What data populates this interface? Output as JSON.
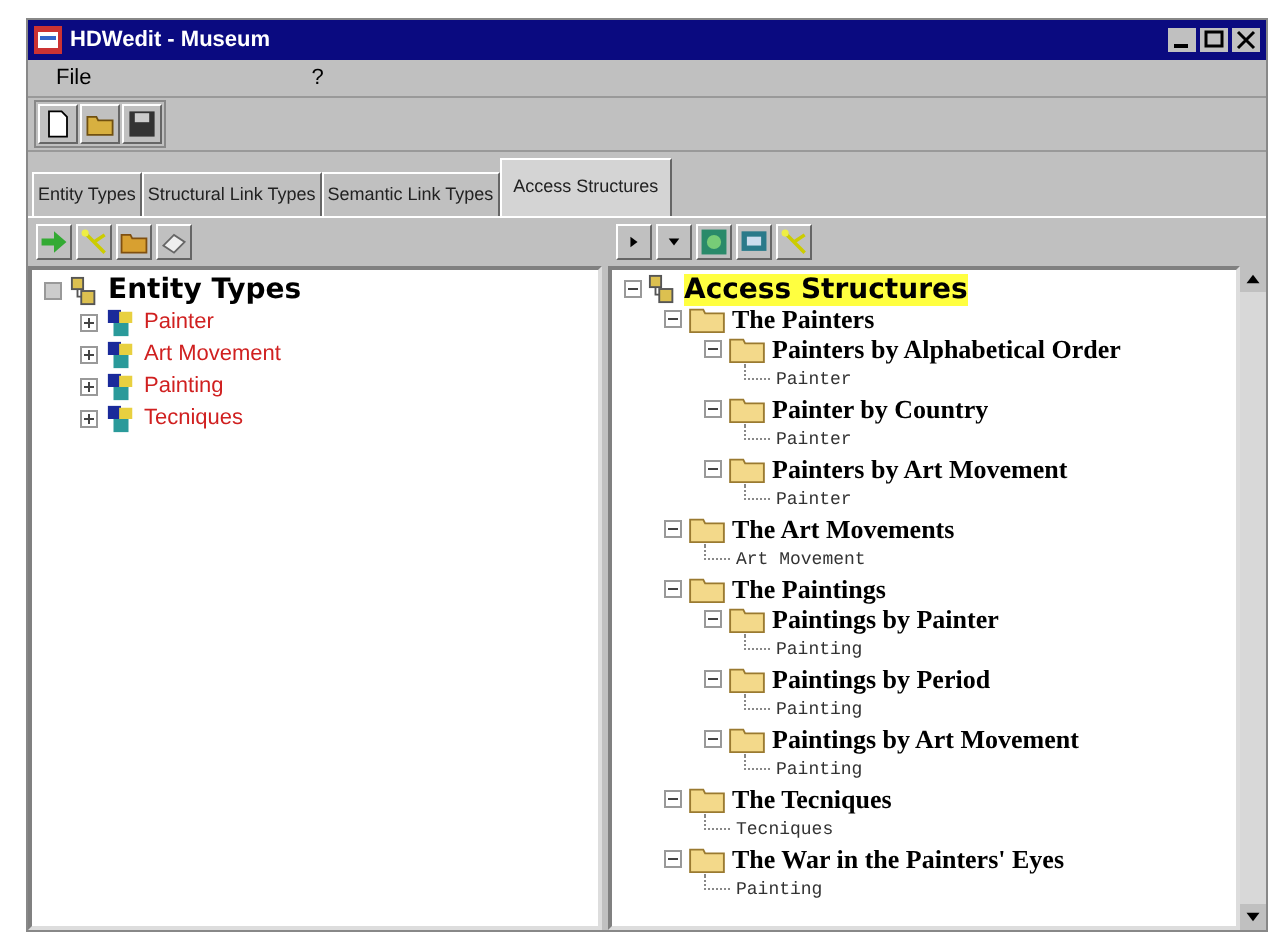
{
  "window": {
    "title": "HDWedit - Museum"
  },
  "menu": [
    "File",
    "?"
  ],
  "tabs": [
    {
      "label": "Entity Types",
      "selected": false
    },
    {
      "label": "Structural Link Types",
      "selected": false
    },
    {
      "label": "Semantic Link Types",
      "selected": false
    },
    {
      "label": "Access Structures",
      "selected": true
    }
  ],
  "entity_tree": {
    "label": "Entity Types",
    "children": [
      {
        "label": "Painter",
        "expanded": false
      },
      {
        "label": "Art Movement",
        "expanded": false
      },
      {
        "label": "Painting",
        "expanded": false
      },
      {
        "label": "Tecniques",
        "expanded": false
      }
    ]
  },
  "access_tree": {
    "label": "Access Structures",
    "selected": true,
    "expanded": true,
    "children": [
      {
        "kind": "folder",
        "label": "The Painters",
        "selected": false,
        "expanded": true,
        "children": [
          {
            "kind": "folder",
            "label": "Painters by Alphabetical Order",
            "selected": false,
            "expanded": true,
            "children": [
              {
                "kind": "ref",
                "label": "Painter",
                "selected": false
              }
            ]
          },
          {
            "kind": "folder",
            "label": "Painter by Country",
            "selected": false,
            "expanded": true,
            "children": [
              {
                "kind": "ref",
                "label": "Painter",
                "selected": false
              }
            ]
          },
          {
            "kind": "folder",
            "label": "Painters by Art Movement",
            "selected": false,
            "expanded": true,
            "children": [
              {
                "kind": "ref",
                "label": "Painter",
                "selected": false
              }
            ]
          }
        ]
      },
      {
        "kind": "folder",
        "label": "The Art Movements",
        "selected": false,
        "expanded": true,
        "children": [
          {
            "kind": "ref",
            "label": "Art Movement",
            "selected": false
          }
        ]
      },
      {
        "kind": "folder",
        "label": "The Paintings",
        "selected": false,
        "expanded": true,
        "children": [
          {
            "kind": "folder",
            "label": "Paintings by Painter",
            "selected": false,
            "expanded": true,
            "children": [
              {
                "kind": "ref",
                "label": "Painting",
                "selected": false
              }
            ]
          },
          {
            "kind": "folder",
            "label": "Paintings by Period",
            "selected": false,
            "expanded": true,
            "children": [
              {
                "kind": "ref",
                "label": "Painting",
                "selected": false
              }
            ]
          },
          {
            "kind": "folder",
            "label": "Paintings by Art Movement",
            "selected": false,
            "expanded": true,
            "children": [
              {
                "kind": "ref",
                "label": "Painting",
                "selected": false
              }
            ]
          }
        ]
      },
      {
        "kind": "folder",
        "label": "The Tecniques",
        "selected": false,
        "expanded": true,
        "children": [
          {
            "kind": "ref",
            "label": "Tecniques",
            "selected": false
          }
        ]
      },
      {
        "kind": "folder",
        "label": "The War in the Painters' Eyes",
        "selected": false,
        "expanded": true,
        "children": [
          {
            "kind": "ref",
            "label": "Painting",
            "selected": false
          }
        ]
      }
    ]
  }
}
